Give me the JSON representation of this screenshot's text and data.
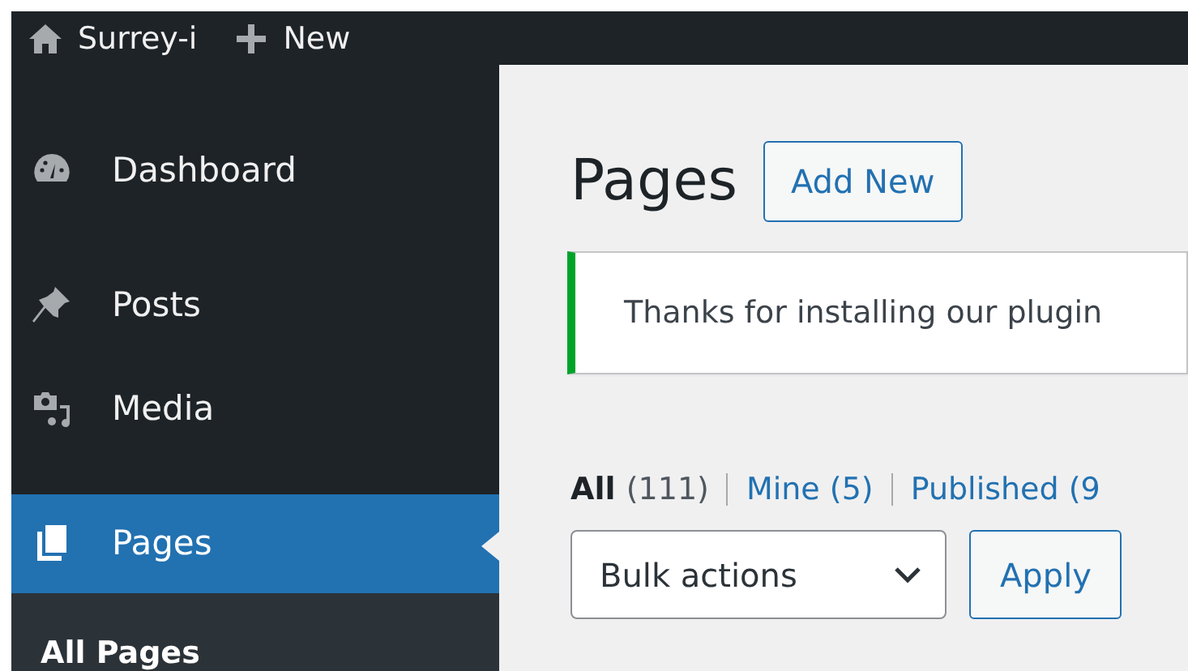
{
  "admin_bar": {
    "items": [
      {
        "kind": "home",
        "label": "Surrey-i"
      },
      {
        "kind": "new",
        "label": "New"
      }
    ]
  },
  "sidebar": {
    "items": [
      {
        "kind": "dashboard",
        "label": "Dashboard",
        "selected": false
      },
      {
        "kind": "posts",
        "label": "Posts",
        "selected": false
      },
      {
        "kind": "media",
        "label": "Media",
        "selected": false
      },
      {
        "kind": "pages",
        "label": "Pages",
        "selected": true
      }
    ],
    "submenu": [
      {
        "label": "All Pages",
        "selected": true
      }
    ]
  },
  "page": {
    "title": "Pages",
    "add_button": "Add New",
    "notice": {
      "text": "Thanks for installing our plugin"
    },
    "filters": [
      {
        "label": "All",
        "count": "(111)",
        "selected": true
      },
      {
        "label": "Mine",
        "count": "(5)",
        "selected": false
      },
      {
        "label": "Published",
        "count": "(9",
        "selected": false
      }
    ],
    "bulk_select": "Bulk actions",
    "apply_button": "Apply"
  }
}
